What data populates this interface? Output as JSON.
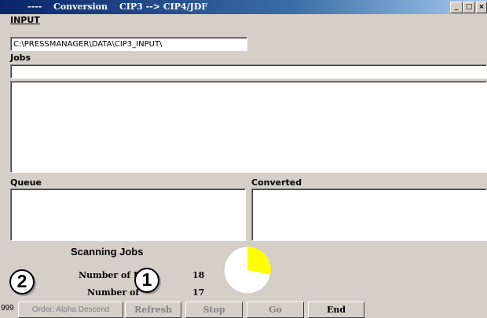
{
  "window": {
    "title_prefix": "----",
    "title_app": "Conversion",
    "title_mode": "CIP3 --> CIP4/JDF",
    "controls": {
      "minimize": "_",
      "maximize": "□",
      "close": "×"
    }
  },
  "input": {
    "label": "INPUT",
    "path": "C:\\PRESSMANAGER\\DATA\\CIP3_INPUT\\"
  },
  "jobs": {
    "label": "Jobs",
    "filter_value": "",
    "items": []
  },
  "queue": {
    "label": "Queue",
    "items": []
  },
  "converted": {
    "label": "Converted",
    "items": []
  },
  "status": {
    "scanning_label": "Scanning Jobs",
    "errors_label": "Number of Er",
    "errors_value": "18",
    "jobs_label": "Number of",
    "jobs_value": "17",
    "progress_fraction": 0.28,
    "progress_color": "#ffff00"
  },
  "toolbar": {
    "count": "999",
    "order_label": "Order: Alpha Descend",
    "refresh_label": "Refresh",
    "stop_label": "Stop",
    "go_label": "Go",
    "end_label": "End"
  },
  "callouts": {
    "one": "1",
    "two": "2"
  }
}
